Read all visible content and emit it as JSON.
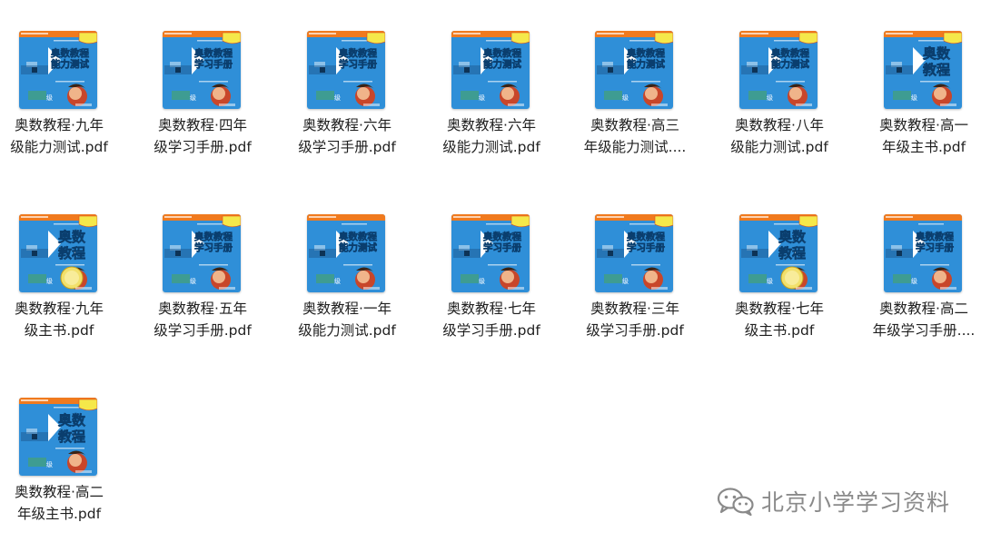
{
  "files": [
    {
      "name_line1": "奥数教程·九年",
      "name_line2": "级能力测试.pdf",
      "cover": "test"
    },
    {
      "name_line1": "奥数教程·四年",
      "name_line2": "级学习手册.pdf",
      "cover": "handbook"
    },
    {
      "name_line1": "奥数教程·六年",
      "name_line2": "级学习手册.pdf",
      "cover": "handbook"
    },
    {
      "name_line1": "奥数教程·六年",
      "name_line2": "级能力测试.pdf",
      "cover": "test"
    },
    {
      "name_line1": "奥数教程·高三",
      "name_line2": "年级能力测试....",
      "cover": "test"
    },
    {
      "name_line1": "奥数教程·八年",
      "name_line2": "级能力测试.pdf",
      "cover": "test"
    },
    {
      "name_line1": "奥数教程·高一",
      "name_line2": "年级主书.pdf",
      "cover": "main"
    },
    {
      "name_line1": "奥数教程·九年",
      "name_line2": "级主书.pdf",
      "cover": "main-badge"
    },
    {
      "name_line1": "奥数教程·五年",
      "name_line2": "级学习手册.pdf",
      "cover": "handbook"
    },
    {
      "name_line1": "奥数教程·一年",
      "name_line2": "级能力测试.pdf",
      "cover": "test-plain"
    },
    {
      "name_line1": "奥数教程·七年",
      "name_line2": "级学习手册.pdf",
      "cover": "handbook"
    },
    {
      "name_line1": "奥数教程·三年",
      "name_line2": "级学习手册.pdf",
      "cover": "handbook"
    },
    {
      "name_line1": "奥数教程·七年",
      "name_line2": "级主书.pdf",
      "cover": "main-badge"
    },
    {
      "name_line1": "奥数教程·高二",
      "name_line2": "年级学习手册....",
      "cover": "handbook-plain"
    },
    {
      "name_line1": "奥数教程·高二",
      "name_line2": "年级主书.pdf",
      "cover": "main"
    }
  ],
  "cover_text": {
    "test_title": "奥数教程\n能力测试",
    "handbook_title": "奥数教程\n学习手册",
    "main_title": "奥数\n教程"
  },
  "colors": {
    "cover_blue": "#2f8fd8",
    "cover_orange": "#f07a1e",
    "cover_yellow_badge": "#f5e84a",
    "text": "#1f1f1f",
    "watermark": "#8a8a8a"
  },
  "watermark": {
    "text": "北京小学学习资料",
    "icon": "wechat-icon"
  }
}
